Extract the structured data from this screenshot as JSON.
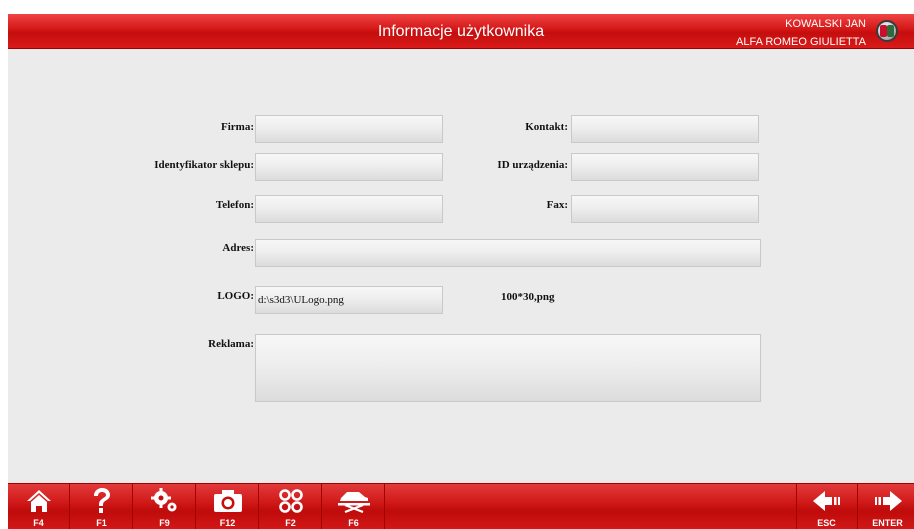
{
  "header": {
    "title": "Informacje użytkownika",
    "user": "KOWALSKI JAN",
    "vehicle": "ALFA ROMEO GIULIETTA",
    "logo_icon": "alfa-romeo-badge"
  },
  "form": {
    "firma_label": "Firma:",
    "firma_value": "",
    "kontakt_label": "Kontakt:",
    "kontakt_value": "",
    "shop_id_label": "Identyfikator sklepu:",
    "shop_id_value": "",
    "device_id_label": "ID urządzenia:",
    "device_id_value": "",
    "telefon_label": "Telefon:",
    "telefon_value": "",
    "fax_label": "Fax:",
    "fax_value": "",
    "adres_label": "Adres:",
    "adres_value": "",
    "logo_label": "LOGO:",
    "logo_value": "d:\\s3d3\\ULogo.png",
    "logo_hint": "100*30,png",
    "reklama_label": "Reklama:",
    "reklama_value": ""
  },
  "toolbar": {
    "buttons": [
      {
        "icon": "home-icon",
        "key": "F4"
      },
      {
        "icon": "help-icon",
        "key": "F1"
      },
      {
        "icon": "settings-icon",
        "key": "F9"
      },
      {
        "icon": "camera-icon",
        "key": "F12"
      },
      {
        "icon": "command-icon",
        "key": "F2"
      },
      {
        "icon": "car-lift-icon",
        "key": "F6"
      }
    ],
    "esc_key": "ESC",
    "enter_key": "ENTER"
  },
  "colors": {
    "header_red": "#d41616",
    "toolbar_red": "#c50d0d",
    "background": "#ebebeb"
  }
}
